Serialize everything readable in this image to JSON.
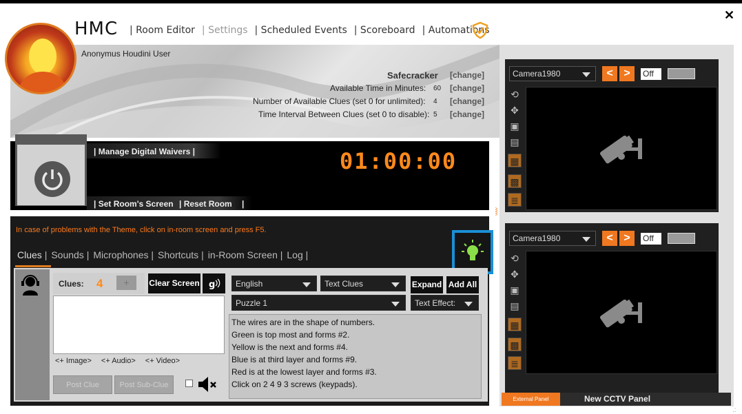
{
  "app": {
    "title": "HMC",
    "close_symbol": "✕"
  },
  "nav": {
    "items": [
      {
        "label": "| Room Editor",
        "state": "normal"
      },
      {
        "label": "| Settings",
        "state": "disabled"
      },
      {
        "label": "| Scheduled Events",
        "state": "normal"
      },
      {
        "label": "| Scoreboard",
        "state": "normal"
      },
      {
        "label": "| Automations",
        "state": "normal"
      }
    ],
    "shield_icon": "shield-check-icon"
  },
  "user": {
    "name": "Anonymus Houdini User"
  },
  "room": {
    "name": "Safecracker",
    "rows": [
      {
        "label": "Available Time in Minutes:",
        "value": "60",
        "action": "[change]"
      },
      {
        "label": "Number of Available Clues (set 0 for unlimited):",
        "value": "4",
        "action": "[change]"
      },
      {
        "label": "Time Interval Between Clues  (set 0 to disable):",
        "value": "5",
        "action": "[change]"
      }
    ],
    "name_action": "[change]"
  },
  "control": {
    "manage_waivers": "| Manage Digital Waivers |",
    "set_screen": "| Set Room's Screen",
    "reset_room": "| Reset Room",
    "end_bar": "|",
    "timer": "01:00:00",
    "collapse_arrows": "^^^^"
  },
  "warning": "In case of problems with the Theme, click on in-room screen and press F5.",
  "tabs": [
    {
      "label": "Clues",
      "sep": "|",
      "active": true
    },
    {
      "label": "Sounds",
      "sep": "|"
    },
    {
      "label": "Microphones",
      "sep": "|"
    },
    {
      "label": "Shortcuts",
      "sep": "|"
    },
    {
      "label": "in-Room Screen",
      "sep": "|"
    },
    {
      "label": "Log",
      "sep": "|"
    }
  ],
  "clues": {
    "label": "Clues:",
    "count": "4",
    "plus": "+",
    "clear_screen": "Clear Screen",
    "sound_icon": "audio-waves-icon",
    "media_links": [
      "<+ Image>",
      "<+ Audio>",
      "<+ Video>"
    ],
    "post_clue": "Post Clue",
    "post_sub_clue": "Post Sub-Clue",
    "mute_icon": "speaker-mute-icon",
    "language": "English",
    "clue_type": "Text Clues",
    "puzzle": "Puzzle 1",
    "text_effect": "Text Effect:",
    "expand": "Expand",
    "add_all": "Add All",
    "list": [
      "The wires are in the shape of numbers.",
      "Green is top most and forms #2.",
      "Yellow is the next and forms #4.",
      "Blue is at third layer and forms #9.",
      "Red is at the lowest layer and forms #3.",
      "Click on 2 4 9 3 screws (keypads)."
    ]
  },
  "cameras": [
    {
      "name": "Camera1980",
      "toggle": "Off",
      "left": "<",
      "right": ">"
    },
    {
      "name": "Camera1980",
      "toggle": "Off",
      "left": "<",
      "right": ">"
    }
  ],
  "footer": {
    "external_panel": "External Panel",
    "new_cctv": "New CCTV Panel"
  },
  "colors": {
    "accent": "#f07820",
    "highlight": "#1a8fd6",
    "bulb": "#8be04a"
  }
}
